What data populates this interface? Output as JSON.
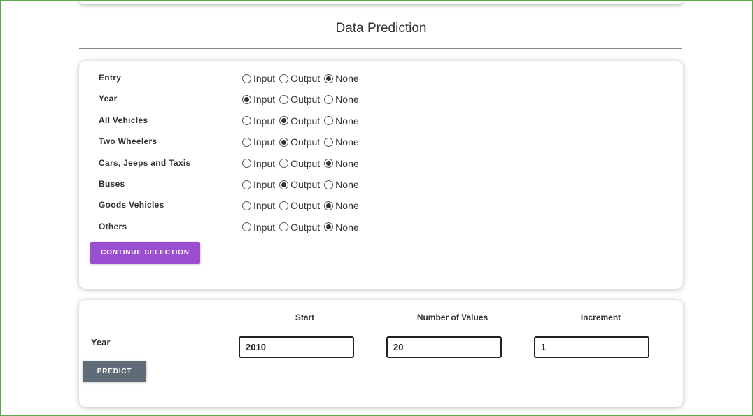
{
  "page": {
    "title": "Data Prediction"
  },
  "column_selection": {
    "options": [
      "Input",
      "Output",
      "None"
    ],
    "rows": [
      {
        "name": "Entry",
        "selected": "None"
      },
      {
        "name": "Year",
        "selected": "Input"
      },
      {
        "name": "All Vehicles",
        "selected": "Output"
      },
      {
        "name": "Two Wheelers",
        "selected": "Output"
      },
      {
        "name": "Cars, Jeeps and Taxis",
        "selected": "None"
      },
      {
        "name": "Buses",
        "selected": "Output"
      },
      {
        "name": "Goods Vehicles",
        "selected": "None"
      },
      {
        "name": "Others",
        "selected": "None"
      }
    ],
    "continue_label": "CONTINUE SELECTION"
  },
  "prediction": {
    "headers": {
      "start": "Start",
      "num_values": "Number of Values",
      "increment": "Increment"
    },
    "row_label": "Year",
    "values": {
      "start": "2010",
      "num_values": "20",
      "increment": "1"
    },
    "predict_label": "PREDICT"
  },
  "colors": {
    "continue_button": "#9b4fd0",
    "predict_button": "#5f6c78",
    "frame": "#5aa84a"
  }
}
